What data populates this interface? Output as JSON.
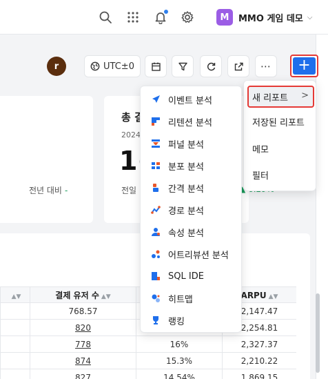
{
  "workspace": {
    "initial": "M",
    "name": "MMO 게임 데모"
  },
  "toolbar": {
    "avatar_initial": "r",
    "timezone": "UTC±0"
  },
  "cards": {
    "left": {
      "yoy_label": "전년 대비",
      "yoy_value": "-"
    },
    "right": {
      "title": "총 결",
      "date": "2024",
      "value": "1(",
      "prev_label": "전일",
      "change": "6.29%"
    }
  },
  "table": {
    "headers": [
      "결제 유저 수",
      "",
      "ARPU"
    ],
    "rows": [
      [
        "768.57",
        "",
        "2,147.47"
      ],
      [
        "820",
        "",
        "2,254.81"
      ],
      [
        "778",
        "16%",
        "2,327.37"
      ],
      [
        "874",
        "15.3%",
        "2,210.22"
      ],
      [
        "827",
        "14.54%",
        "1,869.15"
      ]
    ]
  },
  "main_menu": {
    "items": [
      "새 리포트",
      "저장된 리포트",
      "메모",
      "필터"
    ],
    "arrow": ">"
  },
  "report_submenu": {
    "items": [
      {
        "label": "이벤트 분석",
        "icon": "event-analysis-icon"
      },
      {
        "label": "리텐션 분석",
        "icon": "retention-analysis-icon"
      },
      {
        "label": "퍼널 분석",
        "icon": "funnel-analysis-icon"
      },
      {
        "label": "분포 분석",
        "icon": "distribution-analysis-icon"
      },
      {
        "label": "간격 분석",
        "icon": "interval-analysis-icon"
      },
      {
        "label": "경로 분석",
        "icon": "path-analysis-icon"
      },
      {
        "label": "속성 분석",
        "icon": "property-analysis-icon"
      },
      {
        "label": "어트리뷰션 분석",
        "icon": "attribution-analysis-icon"
      },
      {
        "label": "SQL IDE",
        "icon": "sql-ide-icon"
      },
      {
        "label": "히트맵",
        "icon": "heatmap-icon"
      },
      {
        "label": "랭킹",
        "icon": "ranking-icon"
      }
    ]
  },
  "colors": {
    "accent": "#1f6feb",
    "highlight_border": "#e53935",
    "workspace_badge": "#9b5de5",
    "positive": "#1a9c5b"
  }
}
